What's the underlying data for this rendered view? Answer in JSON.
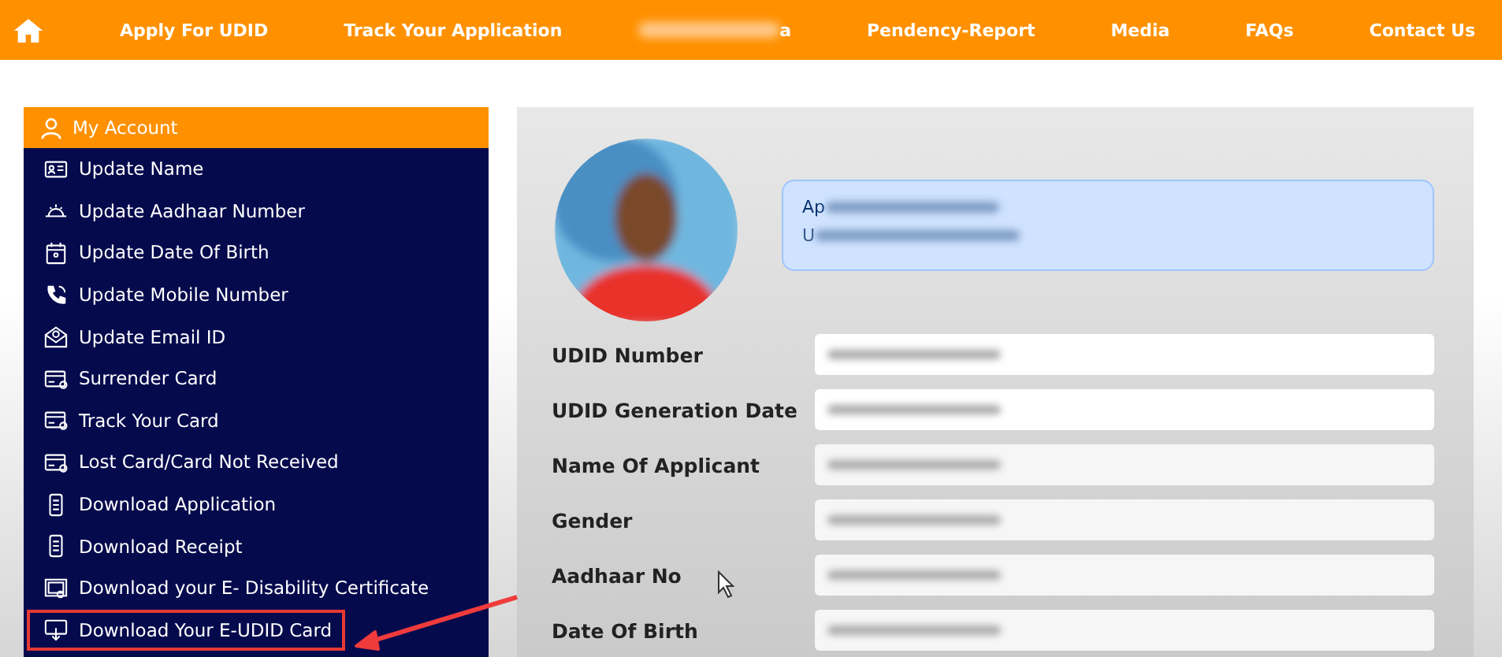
{
  "nav": {
    "items": [
      {
        "label": "Apply For UDID",
        "blurred": false
      },
      {
        "label": "Track Your Application",
        "blurred": false
      },
      {
        "label": "a",
        "blurred": true
      },
      {
        "label": "Pendency-Report",
        "blurred": false
      },
      {
        "label": "Media",
        "blurred": false
      },
      {
        "label": "FAQs",
        "blurred": false
      },
      {
        "label": "Contact Us",
        "blurred": false
      }
    ]
  },
  "sidebar": {
    "header": "My Account",
    "items": [
      {
        "label": "Update Name",
        "kind": "idcard",
        "highlighted": false
      },
      {
        "label": "Update Aadhaar Number",
        "kind": "sun",
        "highlighted": false
      },
      {
        "label": "Update Date Of Birth",
        "kind": "calendar",
        "highlighted": false
      },
      {
        "label": "Update Mobile Number",
        "kind": "phone",
        "highlighted": false
      },
      {
        "label": "Update Email ID",
        "kind": "mail",
        "highlighted": false
      },
      {
        "label": "Surrender Card",
        "kind": "card",
        "highlighted": false
      },
      {
        "label": "Track Your Card",
        "kind": "card",
        "highlighted": false
      },
      {
        "label": "Lost Card/Card Not Received",
        "kind": "card",
        "highlighted": false
      },
      {
        "label": "Download Application",
        "kind": "mobile",
        "highlighted": false
      },
      {
        "label": "Download Receipt",
        "kind": "mobile",
        "highlighted": false
      },
      {
        "label": "Download your E- Disability Certificate",
        "kind": "certificate",
        "highlighted": false
      },
      {
        "label": "Download Your E-UDID Card",
        "kind": "download",
        "highlighted": true
      }
    ]
  },
  "status": {
    "title": "Ap",
    "subtitle": "U"
  },
  "fields": [
    {
      "label": "UDID Number"
    },
    {
      "label": "UDID Generation Date"
    },
    {
      "label": "Name Of Applicant"
    },
    {
      "label": "Gender"
    },
    {
      "label": "Aadhaar No"
    },
    {
      "label": "Date Of Birth"
    }
  ]
}
